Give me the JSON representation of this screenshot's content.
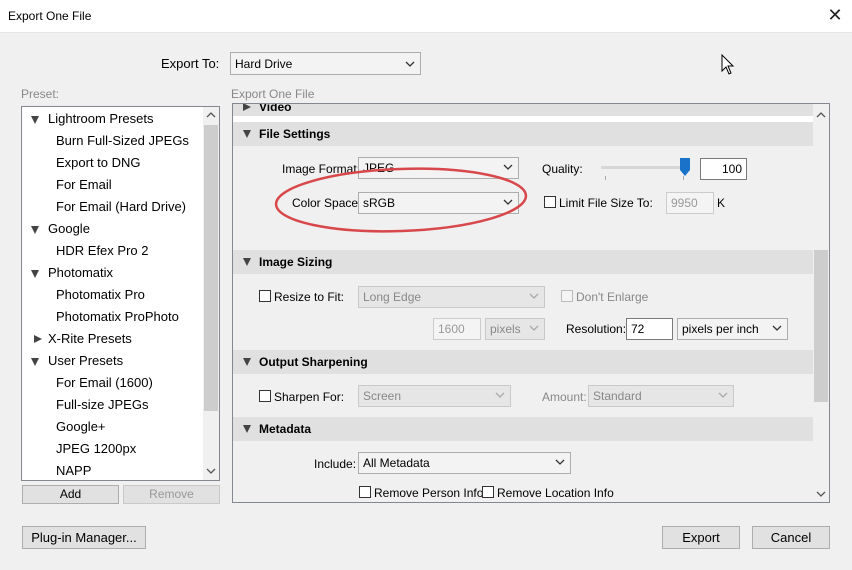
{
  "window": {
    "title": "Export One File",
    "close": "✕"
  },
  "export_to": {
    "label": "Export To:",
    "value": "Hard Drive"
  },
  "preset": {
    "label": "Preset:",
    "items": [
      {
        "label": "Lightroom Presets",
        "indent": 0,
        "expander": "down"
      },
      {
        "label": "Burn Full-Sized JPEGs",
        "indent": 1
      },
      {
        "label": "Export to DNG",
        "indent": 1
      },
      {
        "label": "For Email",
        "indent": 1
      },
      {
        "label": "For Email (Hard Drive)",
        "indent": 1
      },
      {
        "label": "Google",
        "indent": 0,
        "expander": "down"
      },
      {
        "label": "HDR Efex Pro 2",
        "indent": 1
      },
      {
        "label": "Photomatix",
        "indent": 0,
        "expander": "down"
      },
      {
        "label": "Photomatix Pro",
        "indent": 1
      },
      {
        "label": "Photomatix ProPhoto",
        "indent": 1
      },
      {
        "label": "X-Rite Presets",
        "indent": 0,
        "expander": "right"
      },
      {
        "label": "User Presets",
        "indent": 0,
        "expander": "down"
      },
      {
        "label": "For Email (1600)",
        "indent": 1
      },
      {
        "label": "Full-size JPEGs",
        "indent": 1
      },
      {
        "label": "Google+",
        "indent": 1
      },
      {
        "label": "JPEG 1200px",
        "indent": 1
      },
      {
        "label": "NAPP",
        "indent": 1
      }
    ],
    "add": "Add",
    "remove": "Remove"
  },
  "panel_label": "Export One File",
  "sections": {
    "video": "Video",
    "file_settings": {
      "title": "File Settings",
      "image_format_label": "Image Format:",
      "image_format_value": "JPEG",
      "quality_label": "Quality:",
      "quality_value": "100",
      "quality_fraction": 1.0,
      "color_space_label": "Color Space:",
      "color_space_value": "sRGB",
      "limit_label": "Limit File Size To:",
      "limit_value": "9950",
      "limit_unit": "K"
    },
    "image_sizing": {
      "title": "Image Sizing",
      "resize_label": "Resize to Fit:",
      "resize_value": "Long Edge",
      "dont_enlarge": "Don't Enlarge",
      "size_value": "1600",
      "size_unit": "pixels",
      "resolution_label": "Resolution:",
      "resolution_value": "72",
      "resolution_unit": "pixels per inch"
    },
    "output_sharpening": {
      "title": "Output Sharpening",
      "sharpen_label": "Sharpen For:",
      "sharpen_value": "Screen",
      "amount_label": "Amount:",
      "amount_value": "Standard"
    },
    "metadata": {
      "title": "Metadata",
      "include_label": "Include:",
      "include_value": "All Metadata",
      "remove_person": "Remove Person Info",
      "remove_location": "Remove Location Info"
    }
  },
  "footer": {
    "plugin": "Plug-in Manager...",
    "export": "Export",
    "cancel": "Cancel"
  },
  "colors": {
    "annotation": "#d8474a",
    "slider_thumb": "#1a73c8"
  }
}
